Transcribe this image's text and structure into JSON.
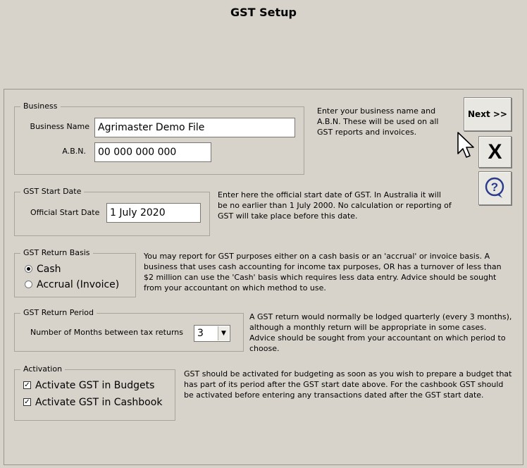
{
  "window": {
    "title": "GST Setup"
  },
  "business": {
    "group_title": "Business",
    "name_label": "Business Name",
    "name_value": "Agrimaster Demo File",
    "abn_label": "A.B.N.",
    "abn_value": "00 000 000 000",
    "help": "Enter your business name and A.B.N. These will be used on all GST reports and invoices."
  },
  "start_date": {
    "group_title": "GST Start Date",
    "label": "Official Start Date",
    "value": "1 July 2020",
    "help": "Enter here the official start date of GST. In Australia it will be no earlier than 1 July 2000. No calculation or reporting of GST will take place before this date."
  },
  "return_basis": {
    "group_title": "GST Return Basis",
    "options": [
      {
        "label": "Cash",
        "selected": true
      },
      {
        "label": "Accrual (Invoice)",
        "selected": false
      }
    ],
    "help": "You may report for GST purposes either on a cash basis or an 'accrual' or invoice basis. A business that uses cash accounting for income tax purposes, OR has a turnover of less than $2 million can use the 'Cash' basis which requires less data entry. Advice should be sought from your accountant on which method to use."
  },
  "return_period": {
    "group_title": "GST Return Period",
    "label": "Number of Months between tax returns",
    "value": "3",
    "help": "A GST return would normally be lodged quarterly (every 3 months), although a monthly return will be appropriate in some cases. Advice should be sought from your accountant on which period to choose."
  },
  "activation": {
    "group_title": "Activation",
    "budgets_label": "Activate GST in Budgets",
    "budgets_checked": true,
    "cashbook_label": "Activate GST in Cashbook",
    "cashbook_checked": true,
    "help": "GST should be activated for budgeting as soon as you wish to prepare a budget that has part of its period after the GST start date above. For the cashbook GST should be activated before entering any transactions dated after the GST start date."
  },
  "buttons": {
    "next_label": "Next >>",
    "close_label": "X",
    "help_icon": "question-mark-icon"
  },
  "colors": {
    "background": "#d7d3cb",
    "help_icon": "#2a3a8c"
  }
}
